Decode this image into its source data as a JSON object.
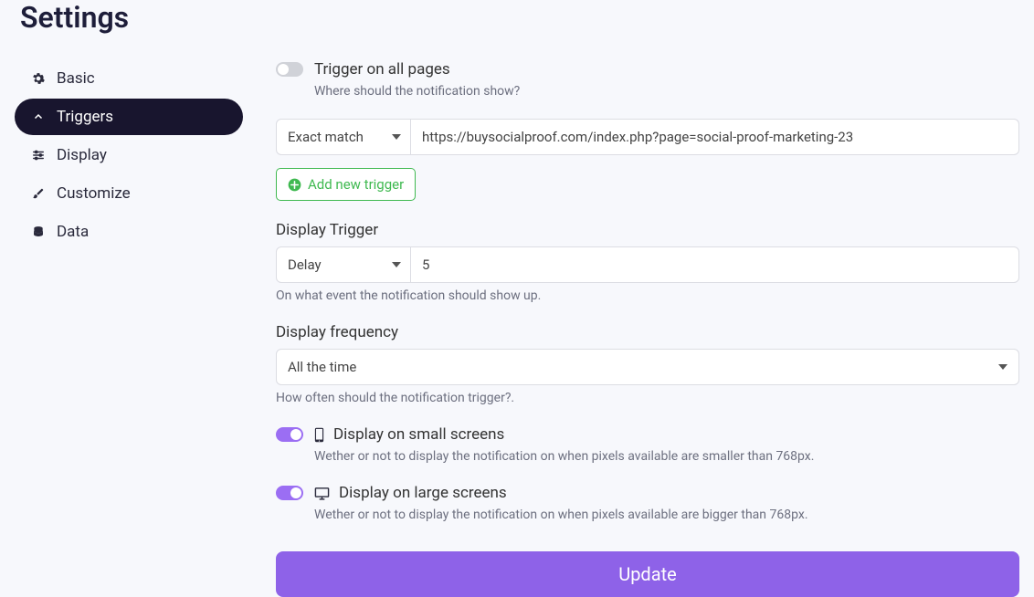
{
  "page_title": "Settings",
  "sidebar": {
    "items": [
      {
        "label": "Basic",
        "icon": "gear"
      },
      {
        "label": "Triggers",
        "icon": "chevron-up",
        "active": true
      },
      {
        "label": "Display",
        "icon": "sliders"
      },
      {
        "label": "Customize",
        "icon": "brush"
      },
      {
        "label": "Data",
        "icon": "database"
      }
    ]
  },
  "main": {
    "trigger_all": {
      "label": "Trigger on all pages",
      "help": "Where should the notification show?",
      "on": false
    },
    "trigger_rule": {
      "match_type": "Exact match",
      "value": "https://buysocialproof.com/index.php?page=social-proof-marketing-23"
    },
    "add_trigger_label": "Add new trigger",
    "display_trigger": {
      "label": "Display Trigger",
      "type": "Delay",
      "value": "5",
      "help": "On what event the notification should show up."
    },
    "display_frequency": {
      "label": "Display frequency",
      "value": "All the time",
      "help": "How often should the notification trigger?."
    },
    "display_small": {
      "label": "Display on small screens",
      "help": "Wether or not to display the notification on when pixels available are smaller than 768px.",
      "on": true
    },
    "display_large": {
      "label": "Display on large screens",
      "help": "Wether or not to display the notification on when pixels available are bigger than 768px.",
      "on": true
    },
    "update_label": "Update"
  }
}
